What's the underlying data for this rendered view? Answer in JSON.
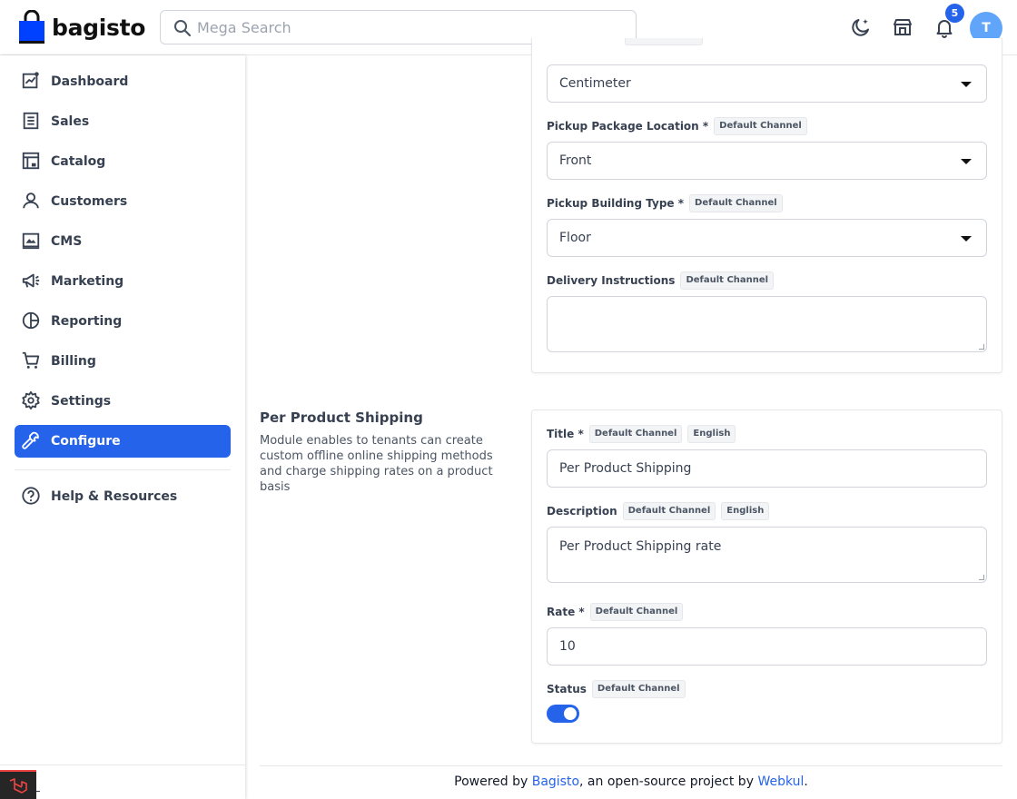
{
  "header": {
    "logo_text": "bagisto",
    "search_placeholder": "Mega Search",
    "notification_count": "5",
    "avatar_initial": "T"
  },
  "sidebar": {
    "items": [
      {
        "label": "Dashboard",
        "icon": "dashboard-icon"
      },
      {
        "label": "Sales",
        "icon": "sales-icon"
      },
      {
        "label": "Catalog",
        "icon": "catalog-icon"
      },
      {
        "label": "Customers",
        "icon": "customers-icon"
      },
      {
        "label": "CMS",
        "icon": "cms-icon"
      },
      {
        "label": "Marketing",
        "icon": "megaphone-icon"
      },
      {
        "label": "Reporting",
        "icon": "pie-chart-icon"
      },
      {
        "label": "Billing",
        "icon": "cart-icon"
      },
      {
        "label": "Settings",
        "icon": "gear-icon"
      },
      {
        "label": "Configure",
        "icon": "wrench-icon"
      }
    ],
    "help_label": "Help & Resources",
    "active_color": "#2563eb"
  },
  "pickup": {
    "unit_value": "Centimeter",
    "location_label": "Pickup Package Location *",
    "location_chip": "Default Channel",
    "location_value": "Front",
    "building_label": "Pickup Building Type *",
    "building_chip": "Default Channel",
    "building_value": "Floor",
    "instructions_label": "Delivery Instructions",
    "instructions_chip": "Default Channel",
    "instructions_value": ""
  },
  "per_product": {
    "title": "Per Product Shipping",
    "description": "Module enables to tenants can create custom offline online shipping methods and charge shipping rates on a product basis",
    "title_label": "Title *",
    "title_chip1": "Default Channel",
    "title_chip2": "English",
    "title_value": "Per Product Shipping",
    "desc_label": "Description",
    "desc_chip1": "Default Channel",
    "desc_chip2": "English",
    "desc_value": "Per Product Shipping rate",
    "rate_label": "Rate *",
    "rate_chip": "Default Channel",
    "rate_value": "10",
    "status_label": "Status",
    "status_chip": "Default Channel",
    "status_on": true
  },
  "footer": {
    "prefix": "Powered by ",
    "link1": "Bagisto",
    "middle": ", an open-source project by ",
    "link2": "Webkul",
    "suffix": "."
  }
}
